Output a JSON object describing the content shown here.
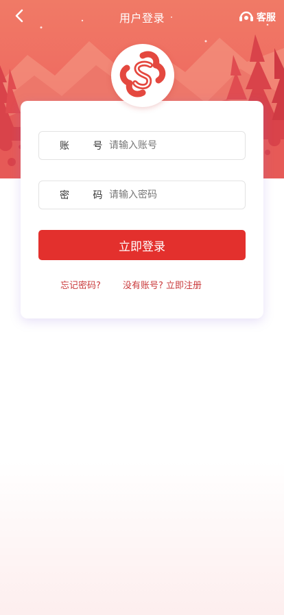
{
  "header": {
    "title": "用户登录",
    "service_label": "客服"
  },
  "form": {
    "account": {
      "label": "账 号",
      "placeholder": "请输入账号",
      "value": ""
    },
    "password": {
      "label": "密 码",
      "placeholder": "请输入密码",
      "value": ""
    },
    "submit_label": "立即登录"
  },
  "links": {
    "forgot": "忘记密码?",
    "register": "没有账号? 立即注册"
  },
  "colors": {
    "primary": "#e3302d",
    "link": "#c9393a",
    "header_bg": "#ef6e62"
  },
  "icons": {
    "back": "chevron-left-icon",
    "service": "headset-icon",
    "logo": "brand-logo"
  }
}
